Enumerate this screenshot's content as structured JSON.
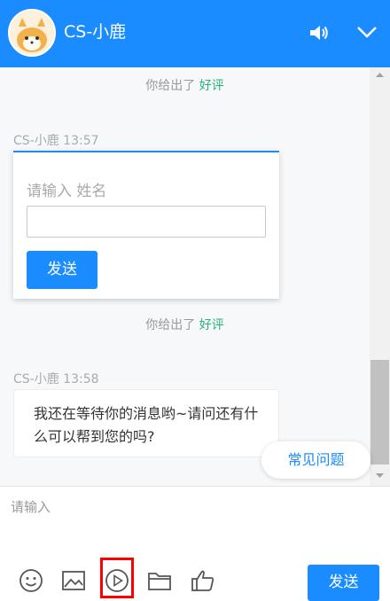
{
  "header": {
    "title": "CS-小鹿",
    "avatar_icon": "deer-mascot-avatar",
    "sound_icon": "speaker-icon",
    "collapse_icon": "chevron-down-icon",
    "bg_color": "#1a8cff"
  },
  "chat": {
    "notice_1": {
      "prefix": "你给出了",
      "rating": "好评"
    },
    "message_1": {
      "sender_time": "CS-小鹿 13:57",
      "form": {
        "label": "请输入 姓名",
        "input_value": "",
        "submit_label": "发送"
      }
    },
    "notice_2": {
      "prefix": "你给出了",
      "rating": "好评"
    },
    "message_2": {
      "sender_time": "CS-小鹿 13:58",
      "text": "我还在等待你的消息哟~请问还有什么可以帮到您的吗?"
    },
    "faq_button": "常见问题"
  },
  "composer": {
    "placeholder": "请输入",
    "tools": [
      "emoji-icon",
      "image-icon",
      "video-play-icon",
      "folder-icon",
      "thumbs-up-icon"
    ],
    "send_label": "发送"
  },
  "colors": {
    "accent": "#1a8cff",
    "rating_green": "#2ab27b",
    "highlight": "#ff0000"
  }
}
